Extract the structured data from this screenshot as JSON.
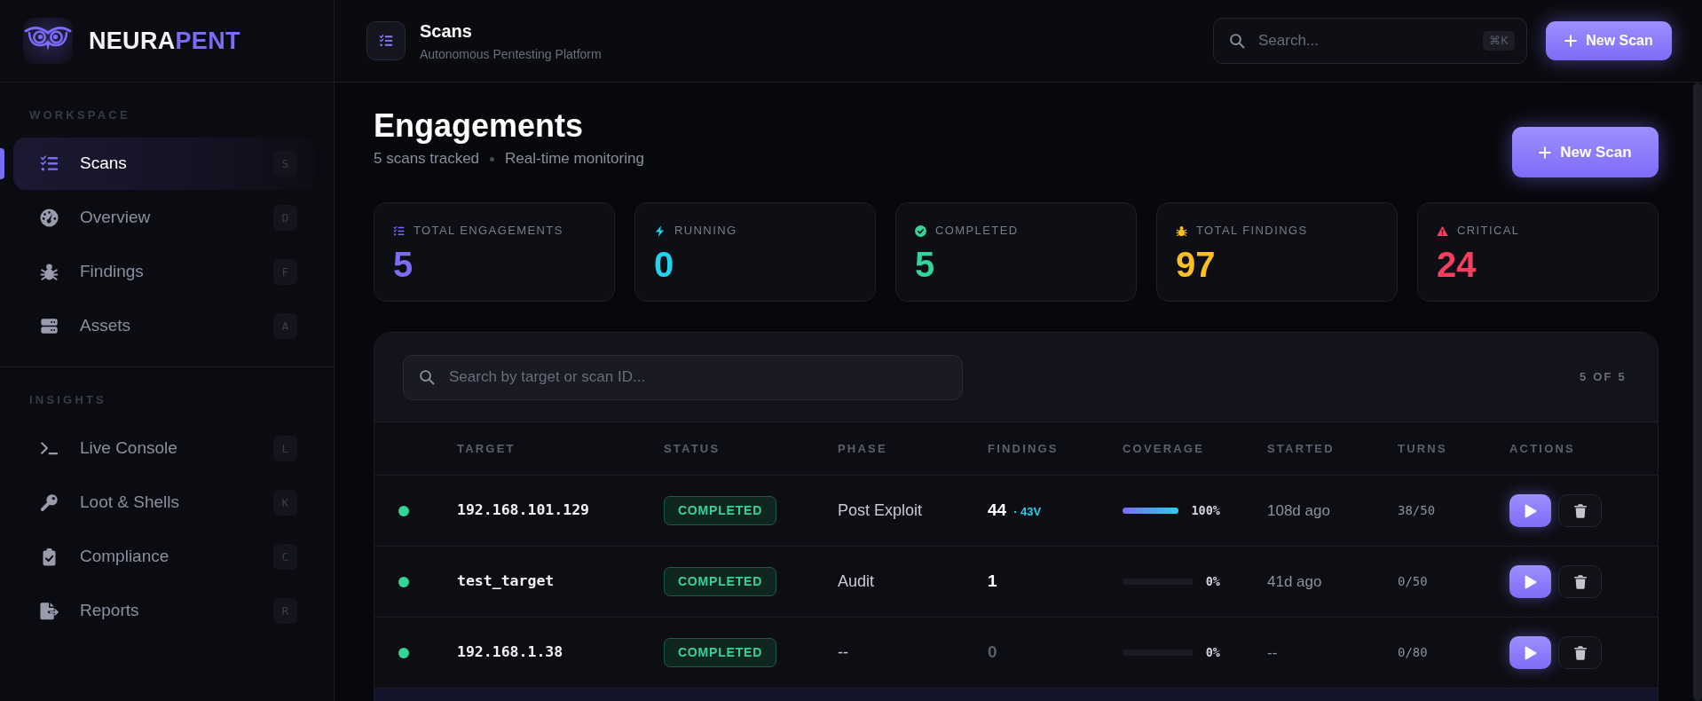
{
  "sidebar": {
    "brand": {
      "name_primary": "NEURA",
      "name_accent": "PENT"
    },
    "sections": [
      {
        "label": "WORKSPACE",
        "items": [
          {
            "label": "Scans",
            "shortcut": "S",
            "selected": true
          },
          {
            "label": "Overview",
            "shortcut": "D",
            "selected": false
          },
          {
            "label": "Findings",
            "shortcut": "F",
            "selected": false
          },
          {
            "label": "Assets",
            "shortcut": "A",
            "selected": false
          }
        ]
      },
      {
        "label": "INSIGHTS",
        "items": [
          {
            "label": "Live Console",
            "shortcut": "L",
            "selected": false
          },
          {
            "label": "Loot & Shells",
            "shortcut": "K",
            "selected": false
          },
          {
            "label": "Compliance",
            "shortcut": "C",
            "selected": false
          },
          {
            "label": "Reports",
            "shortcut": "R",
            "selected": false
          }
        ]
      }
    ]
  },
  "header": {
    "title": "Scans",
    "subtitle": "Autonomous Pentesting Platform",
    "search": {
      "placeholder": "Search...",
      "shortcut": "⌘K"
    },
    "button": "New Scan"
  },
  "page": {
    "title": "Engagements",
    "meta": [
      "5 scans tracked",
      "Real-time monitoring"
    ],
    "button": "New Scan"
  },
  "stats": [
    {
      "label": "TOTAL ENGAGEMENTS",
      "value": "5",
      "color": "#7c6cf6"
    },
    {
      "label": "RUNNING",
      "value": "0",
      "color": "#22d3ee"
    },
    {
      "label": "COMPLETED",
      "value": "5",
      "color": "#34d399"
    },
    {
      "label": "TOTAL FINDINGS",
      "value": "97",
      "color": "#fbbf24"
    },
    {
      "label": "CRITICAL",
      "value": "24",
      "color": "#f43f5e"
    }
  ],
  "table": {
    "search": {
      "placeholder": "Search by target or scan ID..."
    },
    "count": "5 OF 5",
    "columns": [
      "TARGET",
      "STATUS",
      "PHASE",
      "FINDINGS",
      "COVERAGE",
      "STARTED",
      "TURNS",
      "ACTIONS"
    ],
    "rows": [
      {
        "color": "#34d399",
        "target": "192.168.101.129",
        "status": "COMPLETED",
        "phase": "Post Exploit",
        "findings": {
          "count": "44",
          "detail": "· 43V",
          "muted": false
        },
        "coverage": {
          "level": 1,
          "reading": "100%"
        },
        "started": "108d ago",
        "turns": "38/50"
      },
      {
        "color": "#34d399",
        "target": "test_target",
        "status": "COMPLETED",
        "phase": "Audit",
        "findings": {
          "count": "1",
          "muted": false
        },
        "coverage": {
          "level": 0,
          "reading": "0%"
        },
        "started": "41d ago",
        "turns": "0/50"
      },
      {
        "color": "#34d399",
        "target": "192.168.1.38",
        "status": "COMPLETED",
        "phase": "--",
        "findings": {
          "count": "0",
          "muted": true
        },
        "coverage": {
          "level": 0,
          "reading": "0%"
        },
        "started": "--",
        "turns": "0/80"
      }
    ]
  }
}
